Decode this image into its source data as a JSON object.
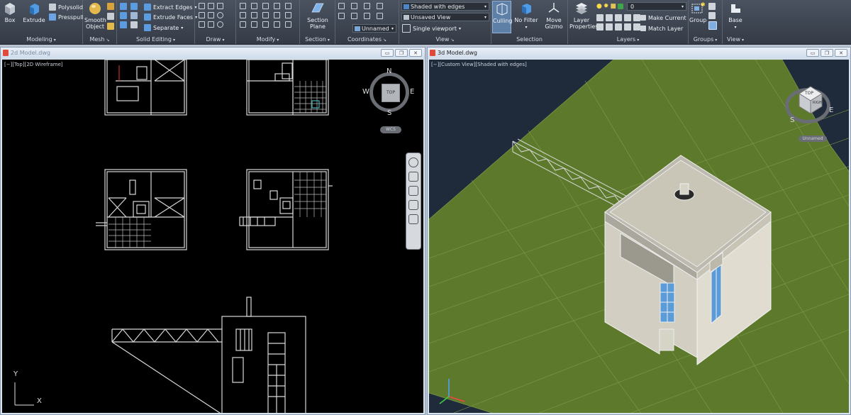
{
  "ribbon": {
    "modeling": {
      "label": "Modeling",
      "box": "Box",
      "extrude": "Extrude",
      "polysolid": "Polysolid",
      "presspull": "Presspull"
    },
    "mesh": {
      "label": "Mesh",
      "smooth_object_1": "Smooth",
      "smooth_object_2": "Object"
    },
    "solid_editing": {
      "label": "Solid Editing",
      "extract_edges": "Extract Edges",
      "extrude_faces": "Extrude Faces",
      "separate": "Separate"
    },
    "draw": {
      "label": "Draw"
    },
    "modify": {
      "label": "Modify"
    },
    "section": {
      "label": "Section",
      "section_plane_1": "Section",
      "section_plane_2": "Plane"
    },
    "coordinates": {
      "label": "Coordinates",
      "ucs_name": "Unnamed"
    },
    "view": {
      "label": "View",
      "visual_style": "Shaded with edges",
      "saved_view": "Unsaved View",
      "viewport": "Single viewport"
    },
    "selection": {
      "label": "Selection",
      "culling": "Culling",
      "no_filter": "No Filter",
      "move_gizmo_1": "Move",
      "move_gizmo_2": "Gizmo"
    },
    "layers": {
      "label": "Layers",
      "layer_properties_1": "Layer",
      "layer_properties_2": "Properties",
      "current_layer": "0",
      "make_current": "Make Current",
      "match_layer": "Match Layer"
    },
    "groups": {
      "label": "Groups",
      "group": "Group"
    },
    "view2": {
      "label": "View",
      "base": "Base"
    }
  },
  "left_window": {
    "title": "2d Model.dwg",
    "viewport_label": "[−][Top][2D Wireframe]",
    "compass": {
      "n": "N",
      "e": "E",
      "s": "S",
      "w": "W",
      "top": "TOP"
    },
    "wcs": "WCS",
    "ucs": {
      "x": "X",
      "y": "Y"
    }
  },
  "right_window": {
    "title": "3d Model.dwg",
    "viewport_label": "[−][Custom View][Shaded with edges]",
    "viewcube_face": "TOP",
    "viewcube_face2": "RIGHT",
    "compass": {
      "e": "E",
      "s": "S"
    },
    "ucs_name": "Unnamed"
  },
  "colors": {
    "ribbon_bg": "#3b424e",
    "drawing_bg": "#000000",
    "model_bg": "#1f2a3b",
    "ground": "#5d7a2c",
    "building": "#c9c6b8",
    "window_glass": "#5b9bd8"
  }
}
